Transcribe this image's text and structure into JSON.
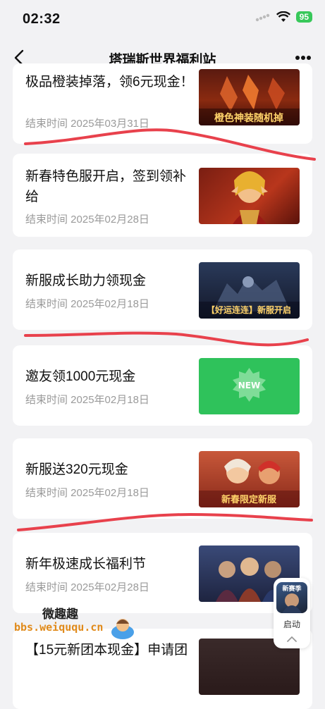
{
  "status": {
    "time": "02:32",
    "battery": "95"
  },
  "header": {
    "title": "塔瑞斯世界福利站"
  },
  "cards": [
    {
      "title": "极品橙装掉落，领6元现金！",
      "date": "结束时间 2025年03月31日",
      "thumb_text": "橙色神装随机掉"
    },
    {
      "title": "新春特色服开启，签到领补给",
      "date": "结束时间 2025年02月28日"
    },
    {
      "title": "新服成长助力领现金",
      "date": "结束时间 2025年02月18日",
      "thumb_text": "【好运连连】新服开启"
    },
    {
      "title": "邀友领1000元现金",
      "date": "结束时间 2025年02月18日",
      "thumb_text": "NEW"
    },
    {
      "title": "新服送320元现金",
      "date": "结束时间 2025年02月18日",
      "thumb_text": "新春限定新服"
    },
    {
      "title": "新年极速成长福利节",
      "date": "结束时间 2025年02月28日"
    },
    {
      "title": "【15元新团本现金】申请团",
      "date": ""
    }
  ],
  "float_widget": {
    "label": "启动",
    "icon_text": "新赛季"
  },
  "watermark": {
    "text": "微趣趣",
    "url": "bbs.weiququ.cn"
  },
  "colors": {
    "background": "#f2f2f4",
    "card": "#ffffff",
    "date_gray": "#9a9a9a",
    "annotation_red": "#e8414c",
    "new_green": "#2fc25b"
  },
  "icons": [
    "back-chevron-icon",
    "more-dots-icon",
    "wifi-icon",
    "cellular-icon",
    "battery-icon"
  ]
}
